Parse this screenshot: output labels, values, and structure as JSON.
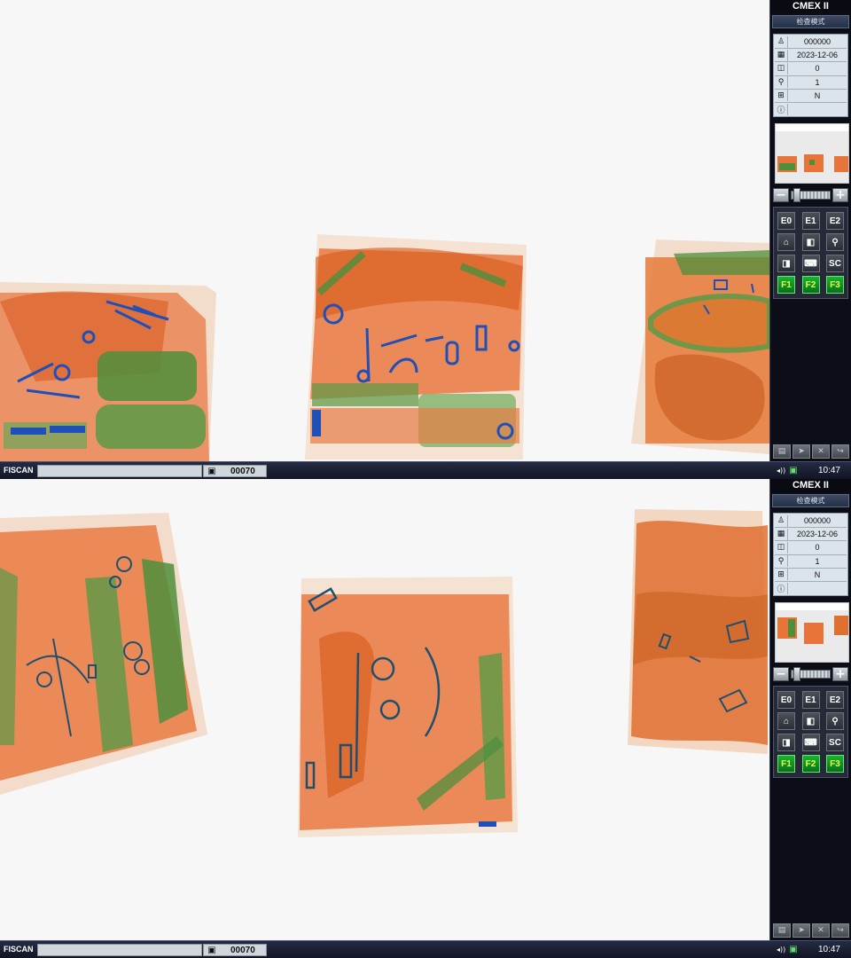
{
  "screens": [
    {
      "app_title": "CMEX II",
      "mode_label": "检查模式",
      "info": [
        {
          "icon": "operator-icon",
          "glyph": "♙",
          "value": "000000"
        },
        {
          "icon": "calendar-icon",
          "glyph": "▦",
          "value": "2023-12-06"
        },
        {
          "icon": "scan-count-icon",
          "glyph": "◫",
          "value": "0"
        },
        {
          "icon": "search-count-icon",
          "glyph": "⚲",
          "value": "1"
        },
        {
          "icon": "conveyor-icon",
          "glyph": "⊞",
          "value": "N"
        },
        {
          "icon": "info-icon",
          "glyph": "ⓘ",
          "value": ""
        }
      ],
      "buttons": [
        "E0",
        "E1",
        "E2",
        "⌂",
        "◧",
        "⚲",
        "◨",
        "⌨",
        "SC",
        "F1",
        "F2",
        "F3"
      ],
      "taskbar": {
        "brand": "FISCAN",
        "bag_count": "00070",
        "clock": "10:47"
      }
    },
    {
      "app_title": "CMEX II",
      "mode_label": "检查模式",
      "info": [
        {
          "icon": "operator-icon",
          "glyph": "♙",
          "value": "000000"
        },
        {
          "icon": "calendar-icon",
          "glyph": "▦",
          "value": "2023-12-06"
        },
        {
          "icon": "scan-count-icon",
          "glyph": "◫",
          "value": "0"
        },
        {
          "icon": "search-count-icon",
          "glyph": "⚲",
          "value": "1"
        },
        {
          "icon": "conveyor-icon",
          "glyph": "⊞",
          "value": "N"
        },
        {
          "icon": "info-icon",
          "glyph": "ⓘ",
          "value": ""
        }
      ],
      "buttons": [
        "E0",
        "E1",
        "E2",
        "⌂",
        "◧",
        "⚲",
        "◨",
        "⌨",
        "SC",
        "F1",
        "F2",
        "F3"
      ],
      "taskbar": {
        "brand": "FISCAN",
        "bag_count": "00070",
        "clock": "10:47"
      }
    }
  ],
  "colors": {
    "organic": "#e8743a",
    "mixed": "#4e8f3c",
    "metal": "#1f4fb8",
    "viewport_bg": "#f7f7f7",
    "function_key": "#16b530"
  }
}
